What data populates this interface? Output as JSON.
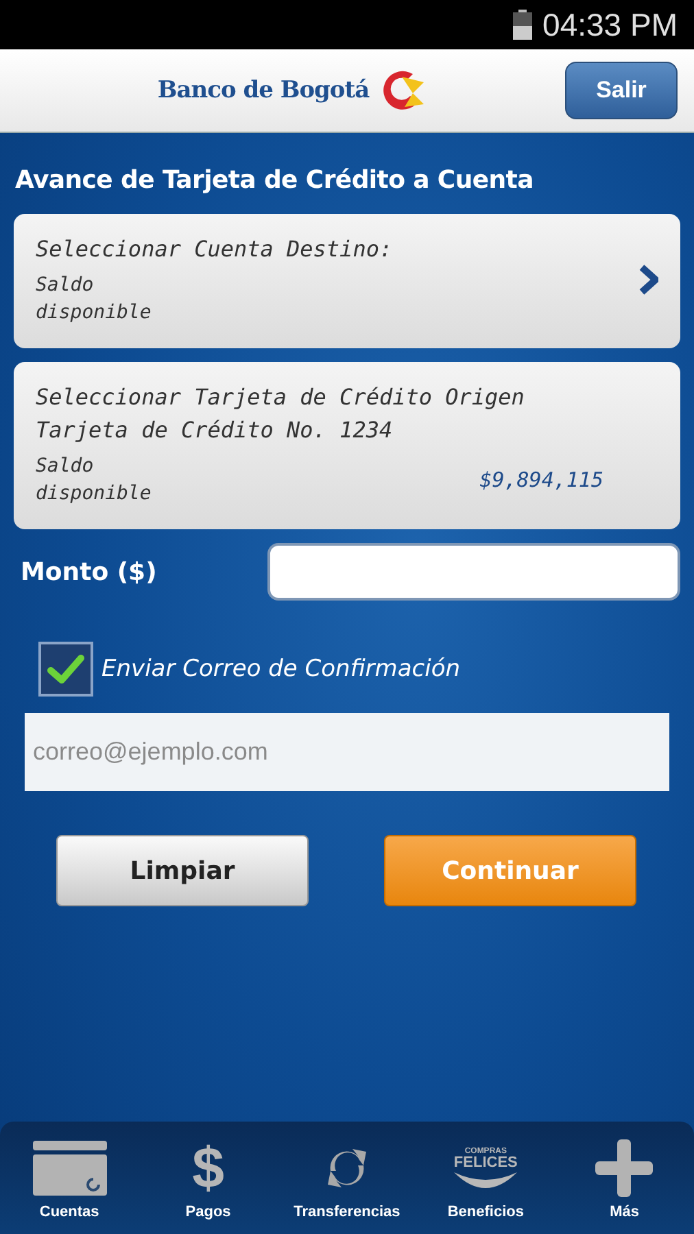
{
  "status_bar": {
    "time": "04:33 PM"
  },
  "header": {
    "brand": "Banco de Bogotá",
    "logout": "Salir"
  },
  "title": "Avance de Tarjeta de Crédito a Cuenta",
  "selectors": [
    {
      "label": "Seleccionar Cuenta Destino:",
      "balance_label": "Saldo disponible",
      "has_arrow": true
    },
    {
      "label": "Seleccionar Tarjeta de Crédito Origen Tarjeta de Crédito No. 1234",
      "balance_label": "Saldo disponible",
      "balance": "$9,894,115",
      "has_arrow": false
    }
  ],
  "amount": {
    "label": "Monto ($)"
  },
  "confirmation": {
    "label": "Enviar Correo de Confirmación",
    "checked": true
  },
  "email": {
    "placeholder": "correo@ejemplo.com"
  },
  "buttons": [
    {
      "label": "Limpiar",
      "kind": "secondary"
    },
    {
      "label": "Continuar",
      "kind": "primary"
    }
  ],
  "nav": [
    {
      "label": "Cuentas",
      "kind": "card"
    },
    {
      "label": "Pagos",
      "kind": "dollar",
      "glyph": "$"
    },
    {
      "label": "Transferencias",
      "kind": "refresh"
    },
    {
      "label": "Beneficios",
      "kind": "felices",
      "logo_top": "COMPRAS",
      "logo_main": "FELICES"
    },
    {
      "label": "Más",
      "kind": "plus"
    }
  ]
}
